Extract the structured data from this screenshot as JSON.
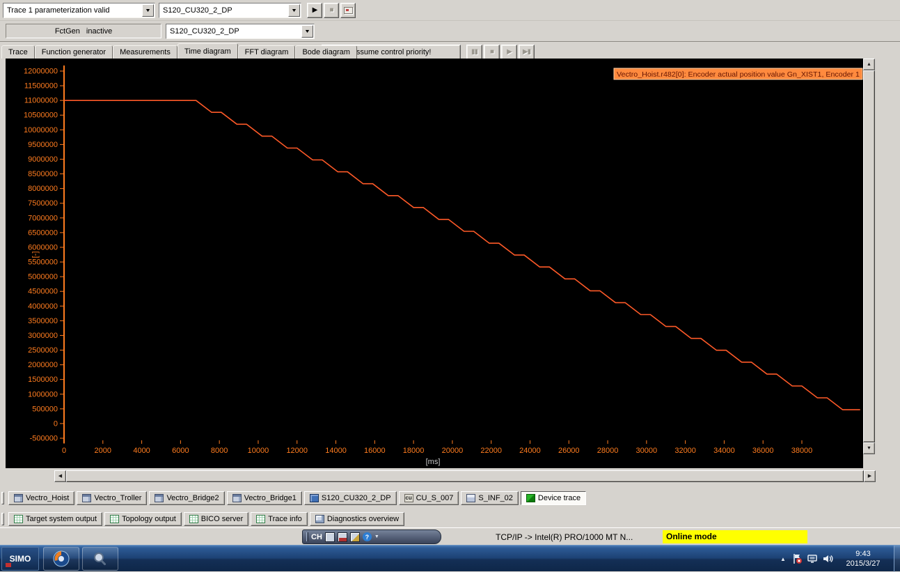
{
  "colors": {
    "trace": "#ff5a28",
    "axis": "#ff7c1f",
    "legend_bg": "#ff8a3e",
    "legend_text": "#641400",
    "online_bg": "#ffff00"
  },
  "icons": {
    "play": "▶",
    "stop": "■",
    "pause": "▮▮",
    "square": "■",
    "step": "▶▮",
    "up_arrow": "▲",
    "down_arrow": "▼",
    "left_arrow": "◀",
    "right_arrow": "▶",
    "dropdown": "▼",
    "tray_expand": "▲",
    "help": "?"
  },
  "toolbar_trace": {
    "status_combo": "Trace 1 parameterization valid",
    "device_combo": "S120_CU320_2_DP"
  },
  "toolbar_fctgen": {
    "name": "FctGen",
    "state": "inactive",
    "device_combo": "S120_CU320_2_DP",
    "assume_button": "Assume control priority!"
  },
  "tabs": [
    {
      "label": "Trace",
      "active": false
    },
    {
      "label": "Function generator",
      "active": false
    },
    {
      "label": "Measurements",
      "active": false
    },
    {
      "label": "Time diagram",
      "active": true
    },
    {
      "label": "FFT diagram",
      "active": false
    },
    {
      "label": "Bode diagram",
      "active": false
    }
  ],
  "chart_data": {
    "type": "line",
    "title": "",
    "xlabel": "[ms]",
    "ylabel": "[-]",
    "xlim": [
      0,
      41000
    ],
    "ylim": [
      -500000,
      12000000
    ],
    "grid": false,
    "legend_position": "top-right",
    "x_ticks": [
      0,
      2000,
      4000,
      6000,
      8000,
      10000,
      12000,
      14000,
      16000,
      18000,
      20000,
      22000,
      24000,
      26000,
      28000,
      30000,
      32000,
      34000,
      36000,
      38000
    ],
    "y_ticks": [
      12000000,
      11500000,
      11000000,
      10500000,
      10000000,
      9500000,
      9000000,
      8500000,
      8000000,
      7500000,
      7000000,
      6500000,
      6000000,
      5500000,
      5000000,
      4500000,
      4000000,
      3500000,
      3000000,
      2500000,
      2000000,
      1500000,
      1000000,
      500000,
      0,
      -500000
    ],
    "series": [
      {
        "name": "Vectro_Hoist.r482[0]: Encoder actual position value Gn_XIST1, Encoder 1",
        "color": "#ff5a28",
        "points": [
          [
            0,
            11000000
          ],
          [
            6800,
            11000000
          ],
          [
            7600,
            10595000
          ],
          [
            8100,
            10595000
          ],
          [
            8900,
            10190000
          ],
          [
            9400,
            10190000
          ],
          [
            10200,
            9785000
          ],
          [
            10700,
            9785000
          ],
          [
            11500,
            9380000
          ],
          [
            12000,
            9380000
          ],
          [
            12800,
            8975000
          ],
          [
            13300,
            8975000
          ],
          [
            14100,
            8570000
          ],
          [
            14600,
            8570000
          ],
          [
            15400,
            8165000
          ],
          [
            15900,
            8165000
          ],
          [
            16700,
            7760000
          ],
          [
            17200,
            7760000
          ],
          [
            18000,
            7355000
          ],
          [
            18500,
            7355000
          ],
          [
            19300,
            6950000
          ],
          [
            19800,
            6950000
          ],
          [
            20600,
            6545000
          ],
          [
            21100,
            6545000
          ],
          [
            21900,
            6140000
          ],
          [
            22400,
            6140000
          ],
          [
            23200,
            5735000
          ],
          [
            23700,
            5735000
          ],
          [
            24500,
            5330000
          ],
          [
            25000,
            5330000
          ],
          [
            25800,
            4925000
          ],
          [
            26300,
            4925000
          ],
          [
            27100,
            4520000
          ],
          [
            27600,
            4520000
          ],
          [
            28400,
            4115000
          ],
          [
            28900,
            4115000
          ],
          [
            29700,
            3710000
          ],
          [
            30200,
            3710000
          ],
          [
            31000,
            3305000
          ],
          [
            31500,
            3305000
          ],
          [
            32300,
            2900000
          ],
          [
            32800,
            2900000
          ],
          [
            33600,
            2495000
          ],
          [
            34100,
            2495000
          ],
          [
            34900,
            2090000
          ],
          [
            35400,
            2090000
          ],
          [
            36200,
            1685000
          ],
          [
            36700,
            1685000
          ],
          [
            37500,
            1280000
          ],
          [
            38000,
            1280000
          ],
          [
            38800,
            875000
          ],
          [
            39300,
            875000
          ],
          [
            40100,
            470000
          ],
          [
            41000,
            470000
          ]
        ]
      }
    ]
  },
  "device_tabs": [
    {
      "label": "Vectro_Hoist",
      "icon": "drive-icon",
      "active": false
    },
    {
      "label": "Vectro_Troller",
      "icon": "drive-icon",
      "active": false
    },
    {
      "label": "Vectro_Bridge2",
      "icon": "drive-icon",
      "active": false
    },
    {
      "label": "Vectro_Bridge1",
      "icon": "drive-icon",
      "active": false
    },
    {
      "label": "S120_CU320_2_DP",
      "icon": "device-icon",
      "active": false
    },
    {
      "label": "CU_S_007",
      "icon": "control-unit-icon",
      "glyph": "cu",
      "active": false
    },
    {
      "label": "S_INF_02",
      "icon": "infeed-icon",
      "active": false
    },
    {
      "label": "Device trace",
      "icon": "trace-icon",
      "active": true
    }
  ],
  "output_tabs": [
    {
      "label": "Target system output",
      "icon": "table-icon"
    },
    {
      "label": "Topology output",
      "icon": "table-icon"
    },
    {
      "label": "BICO server",
      "icon": "table-icon"
    },
    {
      "label": "Trace info",
      "icon": "table-icon"
    },
    {
      "label": "Diagnostics overview",
      "icon": "diagnostics-icon"
    }
  ],
  "ime": {
    "language": "CH"
  },
  "status": {
    "connection": "TCP/IP -> Intel(R) PRO/1000 MT N...",
    "mode": "Online mode"
  },
  "taskbar": {
    "logo": "SIMO",
    "clock_time": "9:43",
    "clock_date": "2015/3/27"
  }
}
